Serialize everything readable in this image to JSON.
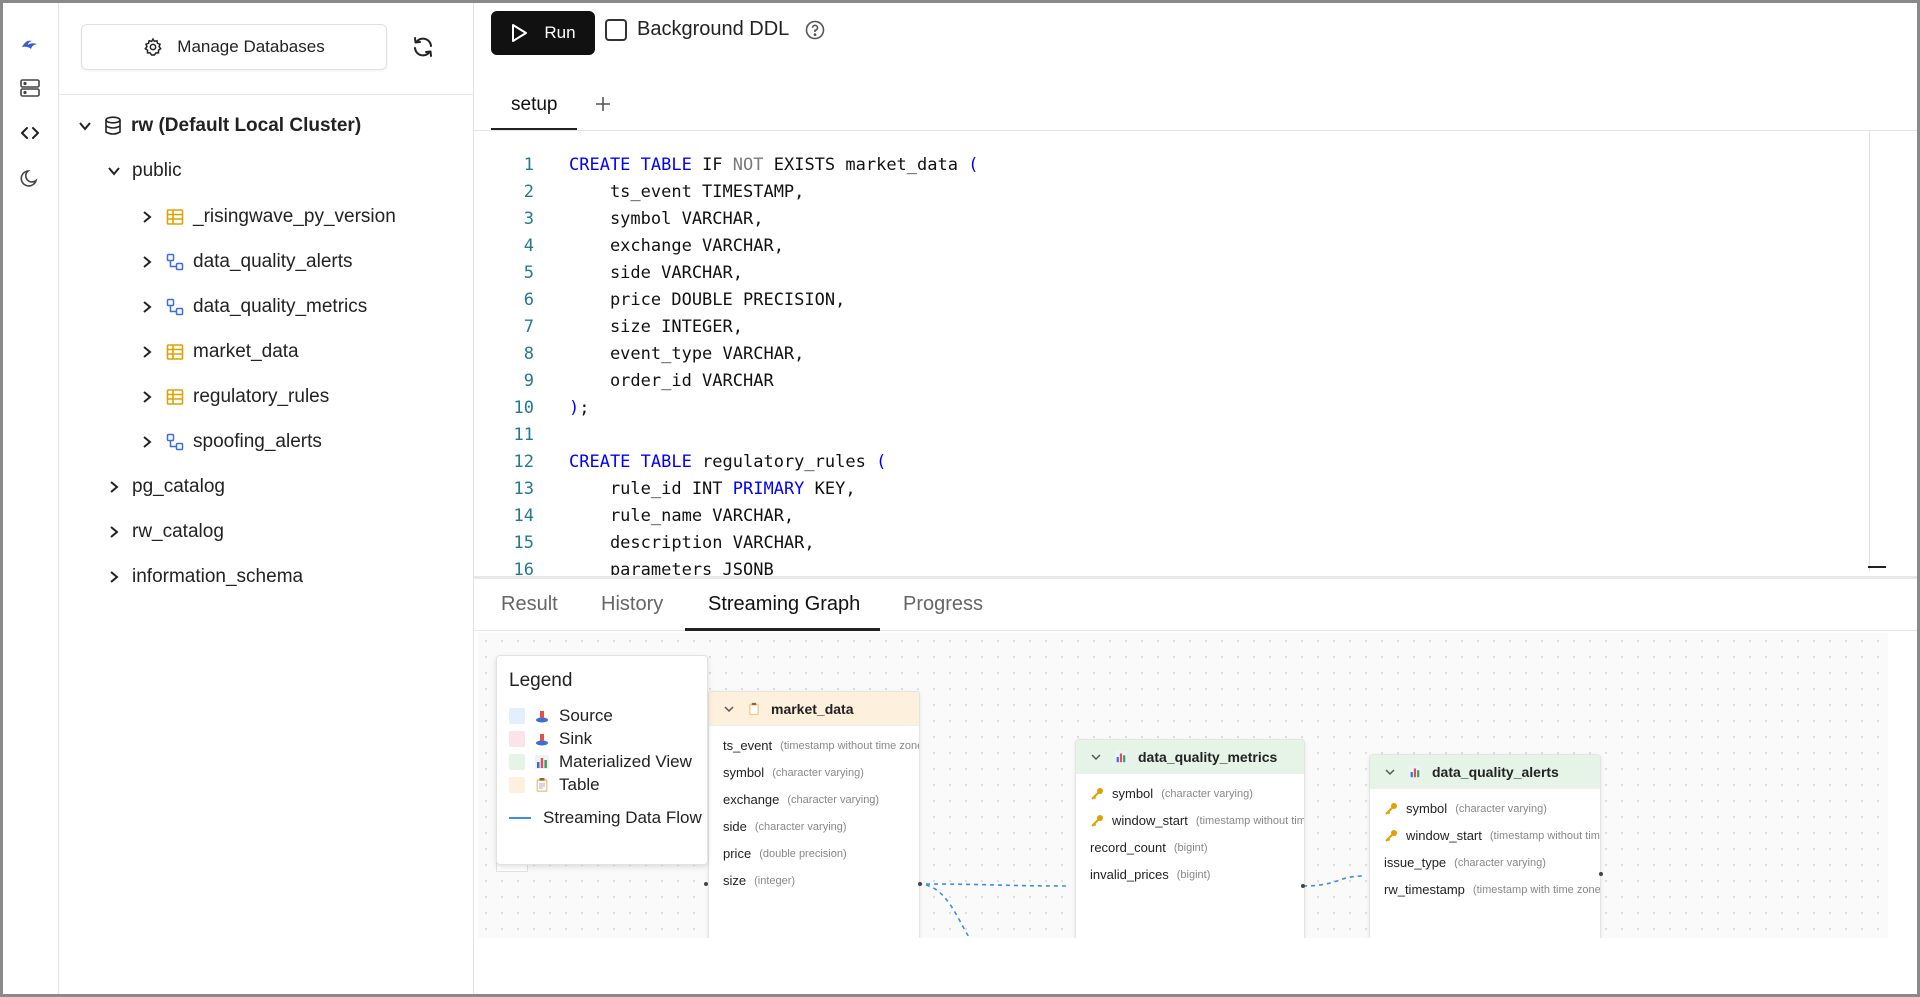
{
  "rail": {
    "icons": [
      "logo-icon",
      "database-icon",
      "code-icon",
      "moon-icon"
    ]
  },
  "sidebar": {
    "manage_label": "Manage Databases",
    "cluster_label": "rw (Default Local Cluster)",
    "schemas": {
      "public": "public",
      "pg_catalog": "pg_catalog",
      "rw_catalog": "rw_catalog",
      "information_schema": "information_schema"
    },
    "objects": [
      {
        "label": "_risingwave_py_version",
        "kind": "table"
      },
      {
        "label": "data_quality_alerts",
        "kind": "materialized-view"
      },
      {
        "label": "data_quality_metrics",
        "kind": "materialized-view"
      },
      {
        "label": "market_data",
        "kind": "table"
      },
      {
        "label": "regulatory_rules",
        "kind": "table"
      },
      {
        "label": "spoofing_alerts",
        "kind": "materialized-view"
      }
    ]
  },
  "toolbar": {
    "run_label": "Run",
    "background_ddl_label": "Background DDL",
    "background_ddl_checked": false
  },
  "editor": {
    "tabs": [
      "setup"
    ],
    "line_numbers": [
      "1",
      "2",
      "3",
      "4",
      "5",
      "6",
      "7",
      "8",
      "9",
      "10",
      "11",
      "12",
      "13",
      "14",
      "15",
      "16"
    ]
  },
  "bottom_tabs": {
    "result": "Result",
    "history": "History",
    "streaming_graph": "Streaming Graph",
    "progress": "Progress",
    "active": "Streaming Graph"
  },
  "legend": {
    "title": "Legend",
    "source": "Source",
    "sink": "Sink",
    "materialized_view": "Materialized View",
    "table": "Table",
    "streaming_flow": "Streaming Data Flow",
    "colors": {
      "source": "#e3effc",
      "sink": "#fce3ea",
      "materialized_view": "#e6f4e8",
      "table": "#fdf0dc",
      "flow": "#3a8ee6"
    }
  },
  "nodes": {
    "market_data": {
      "title": "market_data",
      "columns": [
        {
          "name": "ts_event",
          "type": "(timestamp without time zone)"
        },
        {
          "name": "symbol",
          "type": "(character varying)"
        },
        {
          "name": "exchange",
          "type": "(character varying)"
        },
        {
          "name": "side",
          "type": "(character varying)"
        },
        {
          "name": "price",
          "type": "(double precision)"
        },
        {
          "name": "size",
          "type": "(integer)"
        }
      ]
    },
    "data_quality_metrics": {
      "title": "data_quality_metrics",
      "columns": [
        {
          "name": "symbol",
          "type": "(character varying)"
        },
        {
          "name": "window_start",
          "type": "(timestamp without time zone)"
        },
        {
          "name": "record_count",
          "type": "(bigint)"
        },
        {
          "name": "invalid_prices",
          "type": "(bigint)"
        }
      ]
    },
    "data_quality_alerts": {
      "title": "data_quality_alerts",
      "columns": [
        {
          "name": "symbol",
          "type": "(character varying)"
        },
        {
          "name": "window_start",
          "type": "(timestamp without time zone)"
        },
        {
          "name": "issue_type",
          "type": "(character varying)"
        },
        {
          "name": "rw_timestamp",
          "type": "(timestamp with time zone)"
        }
      ]
    }
  }
}
